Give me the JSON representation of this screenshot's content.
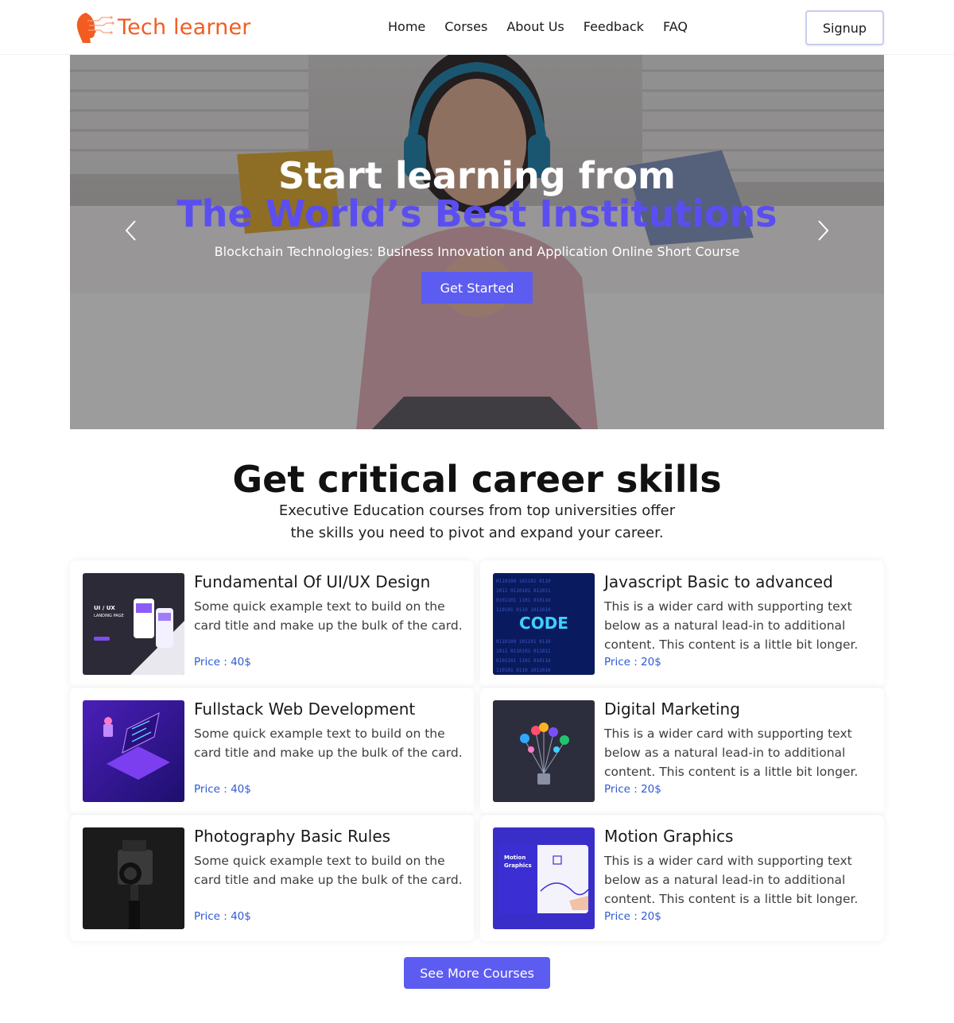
{
  "header": {
    "logo_text": "Tech learner",
    "nav": [
      "Home",
      "Corses",
      "About Us",
      "Feedback",
      "FAQ"
    ],
    "signup_label": "Signup"
  },
  "hero": {
    "title_line1": "Start learning from",
    "title_line2": "The World’s Best Institutions",
    "subtitle": "Blockchain Technologies: Business Innovation and Application Online Short Course",
    "cta_label": "Get Started"
  },
  "section": {
    "title": "Get critical career skills",
    "subtitle_line1": "Executive Education courses from top universities offer",
    "subtitle_line2": "the skills you need to pivot and expand your career."
  },
  "courses": [
    {
      "title": "Fundamental Of UI/UX Design",
      "text": "Some quick example text to build on the card title and make up the bulk of the card.",
      "price": "Price : 40$",
      "thumb": "ui-ux-landing-page"
    },
    {
      "title": "Javascript Basic to advanced",
      "text": "This is a wider card with supporting text below as a natural lead-in to additional content. This content is a little bit longer.",
      "price": "Price : 20$",
      "thumb": "code-binary",
      "thumb_label": "CODE"
    },
    {
      "title": "Fullstack Web Development",
      "text": "Some quick example text to build on the card title and make up the bulk of the card.",
      "price": "Price : 40$",
      "thumb": "isometric-laptop"
    },
    {
      "title": "Digital Marketing",
      "text": "This is a wider card with supporting text below as a natural lead-in to additional content. This content is a little bit longer.",
      "price": "Price : 20$",
      "thumb": "social-lightbulb"
    },
    {
      "title": "Photography Basic Rules",
      "text": "Some quick example text to build on the card title and make up the bulk of the card.",
      "price": "Price : 40$",
      "thumb": "camera-tripod"
    },
    {
      "title": "Motion Graphics",
      "text": "This is a wider card with supporting text below as a natural lead-in to additional content. This content is a little bit longer.",
      "price": "Price : 20$",
      "thumb": "motion-graphics"
    }
  ],
  "more_label": "See More Courses",
  "colors": {
    "brand_orange": "#f25c22",
    "accent_purple": "#5d5cf0",
    "price_blue": "#2f5ad6"
  }
}
